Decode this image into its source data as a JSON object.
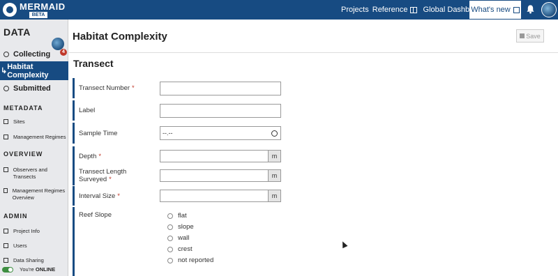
{
  "header": {
    "logo_name": "MERMAID",
    "logo_badge": "BETA",
    "nav": [
      "Projects",
      "Reference",
      "Global Dashboard"
    ],
    "whats_new": "What's new"
  },
  "sidebar": {
    "title": "DATA",
    "collecting": "Collecting",
    "collecting_count": "4",
    "active_item": "Habitat Complexity",
    "active_prefix": "↳",
    "submitted": "Submitted",
    "sections": {
      "metadata": "METADATA",
      "overview": "OVERVIEW",
      "admin": "ADMIN"
    },
    "metadata_items": [
      "Sites",
      "Management Regimes"
    ],
    "overview_items": [
      "Observers and Transects",
      "Management Regimes Overview"
    ],
    "admin_items": [
      "Project Info",
      "Users",
      "Data Sharing"
    ],
    "online_prefix": "You're ",
    "online_status": "ONLINE"
  },
  "page": {
    "title": "Habitat Complexity",
    "save_label": "Save"
  },
  "form": {
    "section_title": "Transect",
    "fields": {
      "transect_number": "Transect Number",
      "label": "Label",
      "sample_time": "Sample Time",
      "sample_time_value": "--.--",
      "depth": "Depth",
      "transect_length": "Transect Length Surveyed",
      "interval_size": "Interval Size",
      "reef_slope": "Reef Slope"
    },
    "unit": "m",
    "required_marker": "*",
    "reef_slope_options": [
      "flat",
      "slope",
      "wall",
      "crest",
      "not reported"
    ]
  }
}
